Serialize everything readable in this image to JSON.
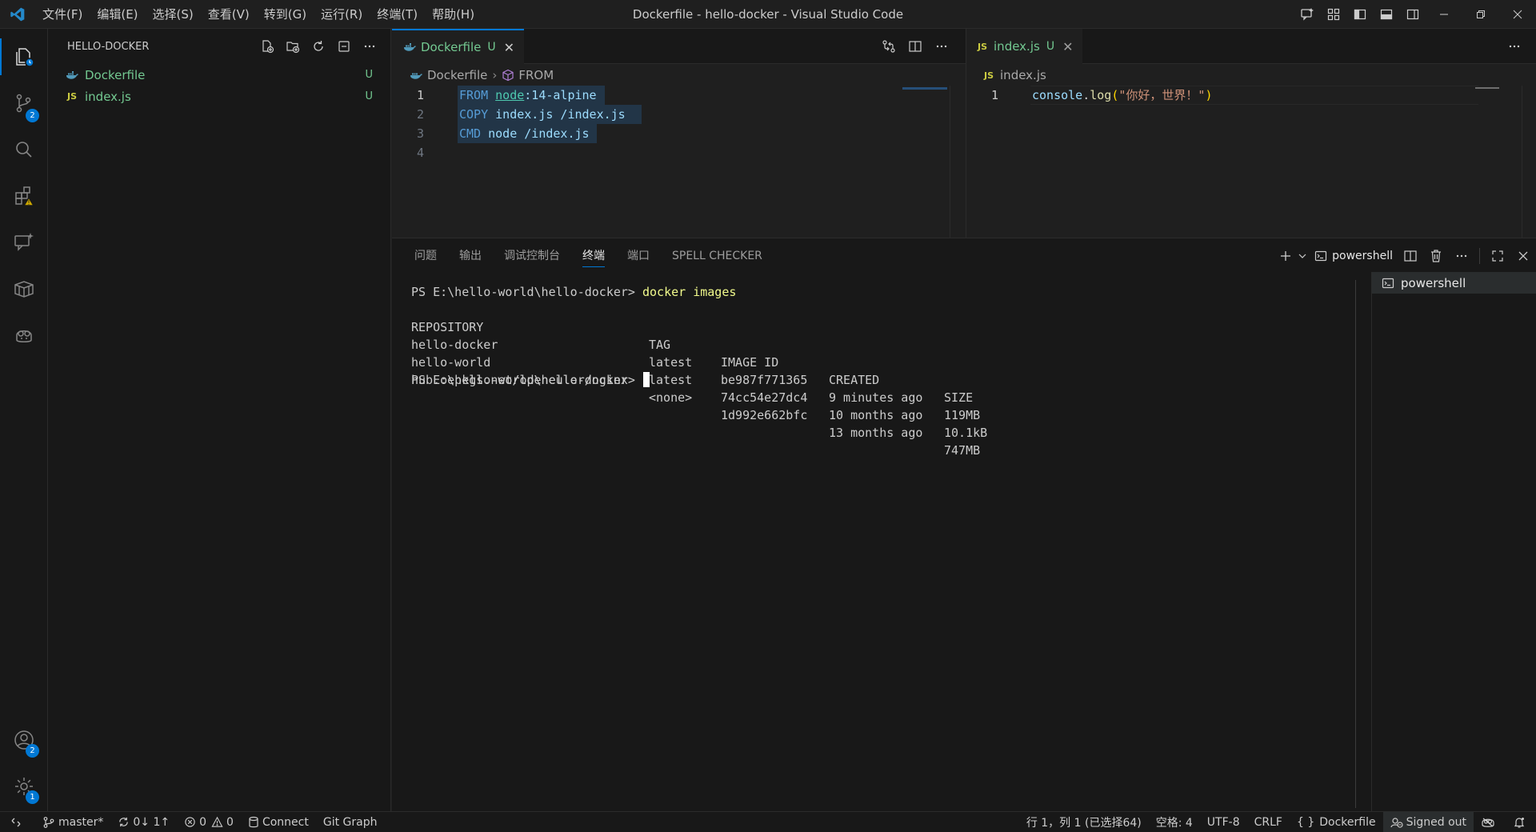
{
  "window": {
    "title": "Dockerfile - hello-docker - Visual Studio Code"
  },
  "menu": [
    "文件(F)",
    "编辑(E)",
    "选择(S)",
    "查看(V)",
    "转到(G)",
    "运行(R)",
    "终端(T)",
    "帮助(H)"
  ],
  "activity_bar": {
    "scm_badge": "2",
    "accounts_badge": "2",
    "settings_badge": "1"
  },
  "explorer": {
    "title": "HELLO-DOCKER",
    "files": [
      {
        "name": "Dockerfile",
        "icon": "docker-icon",
        "status": "U"
      },
      {
        "name": "index.js",
        "icon": "js-icon",
        "status": "U"
      }
    ]
  },
  "editor_left": {
    "tab": {
      "label": "Dockerfile",
      "status": "U"
    },
    "breadcrumb": {
      "file": "Dockerfile",
      "symbol": "FROM"
    },
    "lines": [
      {
        "num": "1",
        "kw": "FROM",
        "a": "node",
        "b": ":14-alpine",
        "c": ""
      },
      {
        "num": "2",
        "kw": "COPY",
        "a": "index.js",
        "b": " /index.js",
        "c": ""
      },
      {
        "num": "3",
        "kw": "CMD",
        "a": "node",
        "b": " /index.js",
        "c": ""
      },
      {
        "num": "4",
        "kw": "",
        "a": "",
        "b": "",
        "c": ""
      }
    ]
  },
  "editor_right": {
    "tab": {
      "label": "index.js",
      "status": "U",
      "icon_text": "JS"
    },
    "breadcrumb": {
      "file": "index.js"
    },
    "lines": [
      {
        "num": "1",
        "code_obj": "console",
        "code_dot": ".",
        "code_fn": "log",
        "code_open": "(",
        "code_str": "\"你好，世界！\"",
        "code_close": ")"
      }
    ]
  },
  "panel": {
    "tabs": [
      "问题",
      "输出",
      "调试控制台",
      "终端",
      "端口",
      "SPELL CHECKER"
    ],
    "active_tab": "终端",
    "shell_label": "powershell",
    "terminal_list": [
      "powershell"
    ],
    "terminal": {
      "prompt": "PS E:\\hello-world\\hello-docker> ",
      "command": "docker images",
      "table": {
        "headers": [
          "REPOSITORY",
          "TAG",
          "IMAGE ID",
          "CREATED",
          "SIZE"
        ],
        "rows": [
          [
            "hello-docker",
            "latest",
            "be987f771365",
            "9 minutes ago",
            "119MB"
          ],
          [
            "hello-world",
            "latest",
            "74cc54e27dc4",
            "10 months ago",
            "10.1kB"
          ],
          [
            "hub.oepkgs.net/openeuler/nginx",
            "<none>",
            "1d992e662bfc",
            "13 months ago",
            "747MB"
          ]
        ]
      },
      "prompt2": "PS E:\\hello-world\\hello-docker> "
    }
  },
  "status_bar": {
    "branch": "master*",
    "sync": "0↓ 1↑",
    "errors": "0",
    "warnings": "0",
    "connect": "Connect",
    "git_graph": "Git Graph",
    "position": "行 1，列 1 (已选择64)",
    "spaces": "空格: 4",
    "encoding": "UTF-8",
    "eol": "CRLF",
    "language": "Dockerfile",
    "signed_out": "Signed out"
  },
  "colors": {
    "accent": "#0078d4",
    "keyword": "#569cd6",
    "string": "#ce9178",
    "untracked": "#73c991",
    "js": "#cbcb41",
    "docker": "#519aba"
  }
}
